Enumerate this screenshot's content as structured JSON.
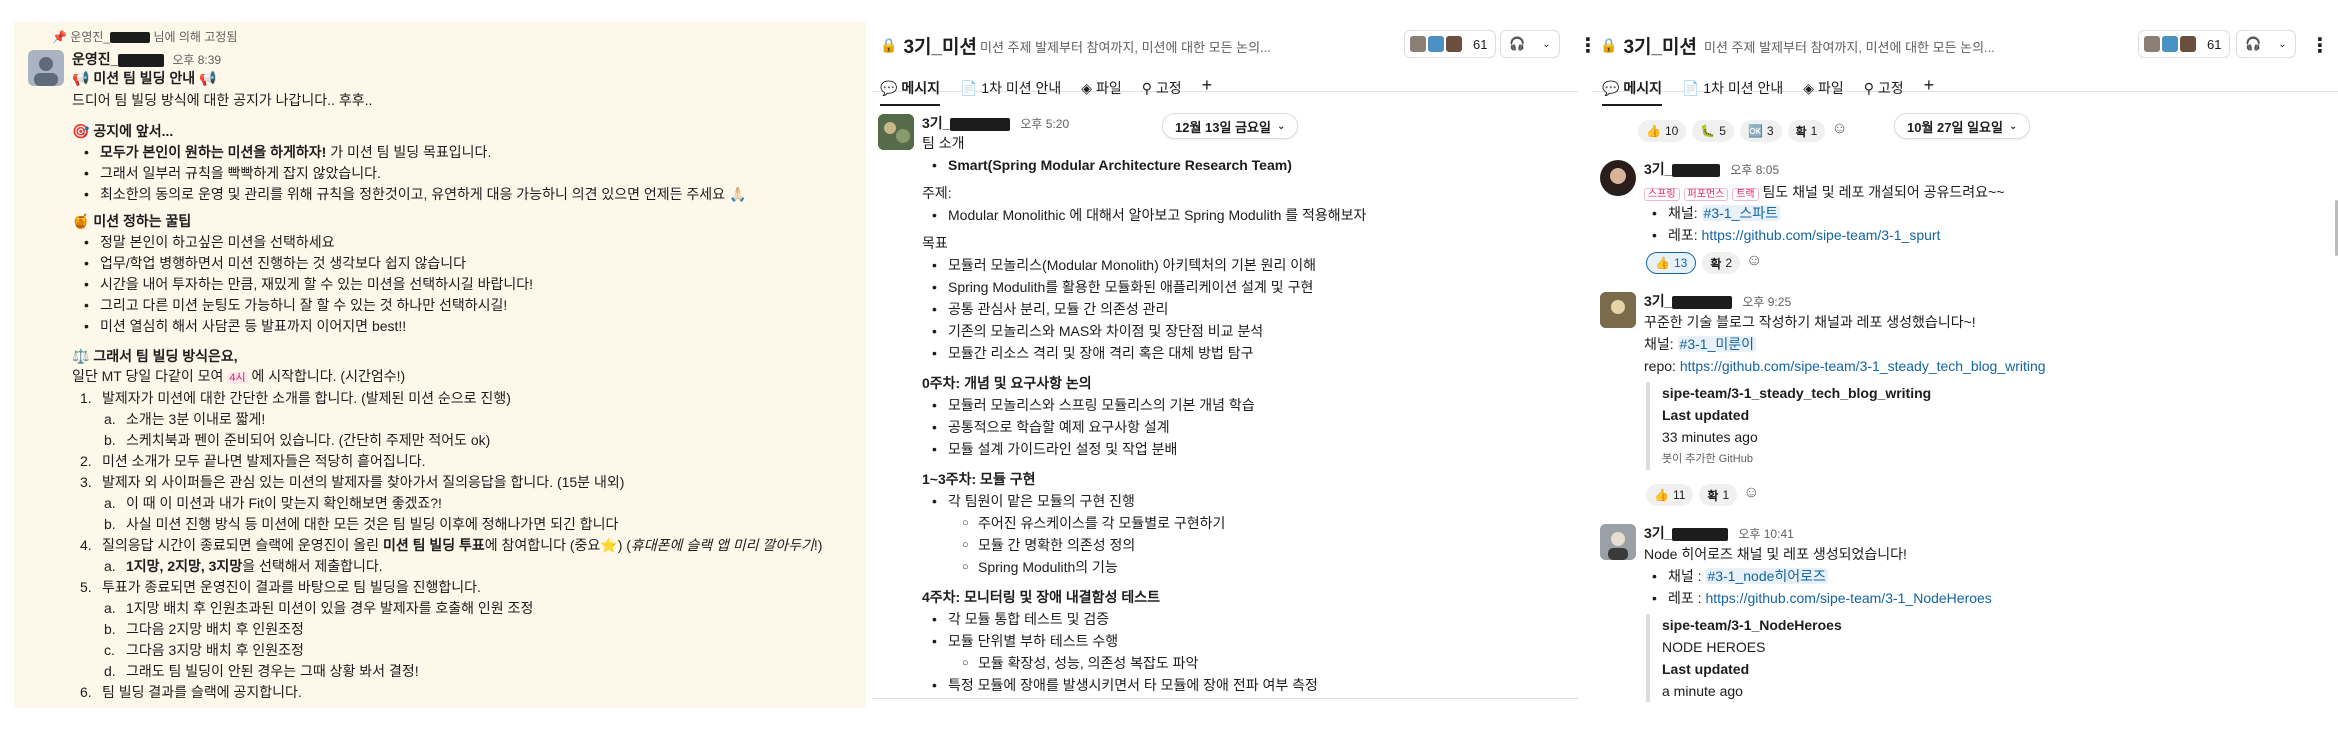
{
  "panel1": {
    "pinned_by": "운영진_",
    "pinned_suffix": "님에 의해 고정됨",
    "author": "운영진_",
    "time": "오후 8:39",
    "title": "📢 미션 팀 빌딩 안내 📢",
    "intro": "드디어 팀 빌딩 방식에 대한 공지가 나갑니다.. 후후..",
    "s1_title": "🎯 공지에 앞서...",
    "s1_items": [
      {
        "bold": "모두가 본인이 원하는 미션을 하게하자!",
        "rest": " 가 미션 팀 빌딩 목표입니다."
      },
      {
        "bold": "",
        "rest": "그래서 일부러 규칙을 빡빡하게 잡지 않았습니다."
      },
      {
        "bold": "",
        "rest": "최소한의 동의로 운영 및 관리를 위해 규칙을 정한것이고, 유연하게 대응 가능하니 의견 있으면 언제든 주세요 🙏🏻"
      }
    ],
    "s2_title": "🍯 미션 정하는 꿀팁",
    "s2_items": [
      "정말 본인이 하고싶은 미션을 선택하세요",
      "업무/학업 병행하면서 미션 진행하는 것 생각보다 쉽지 않습니다",
      "시간을 내어 투자하는 만큼, 재밌게 할 수 있는 미션을 선택하시길 바랍니다!",
      "그리고 다른 미션 눈팅도 가능하니 잘 할 수 있는 것 하나만 선택하시길!",
      "미션 열심히 해서 사담콘 등 발표까지 이어지면 best!!"
    ],
    "s3_title": "⚖️ 그래서 팀 빌딩 방식은요,",
    "s3_intro_a": "일단 MT 당일 다같이 모여 ",
    "s3_intro_time": "4시",
    "s3_intro_b": " 에 시작합니다. (시간엄수!)",
    "steps": [
      {
        "n": "1.",
        "text": "발제자가 미션에 대한 간단한 소개를 합니다. (발제된 미션 순으로 진행)"
      },
      {
        "n": "a.",
        "text": "소개는 3분 이내로 짧게!",
        "sub": true
      },
      {
        "n": "b.",
        "text": "스케치북과 펜이 준비되어 있습니다. (간단히 주제만 적어도 ok)",
        "sub": true
      },
      {
        "n": "2.",
        "text": "미션 소개가 모두 끝나면 발제자들은 적당히 흩어집니다."
      },
      {
        "n": "3.",
        "text": "발제자 외 사이퍼들은 관심 있는 미션의 발제자를 찾아가서 질의응답을 합니다. (15분 내외)"
      },
      {
        "n": "a.",
        "text": "이 때 이 미션과 내가 Fit이 맞는지 확인해보면 좋겠죠?!",
        "sub": true
      },
      {
        "n": "b.",
        "text": "사실 미션 진행 방식 등 미션에 대한 모든 것은 팀 빌딩 이후에 정해나가면 되긴 합니다",
        "sub": true
      },
      {
        "n": "4.",
        "text": "질의응답 시간이 종료되면 슬랙에 운영진이 올린 ",
        "bold": "미션 팀 빌딩 투표",
        "tail": "에 참여합니다 (중요⭐️) (",
        "italic": "휴대폰에 슬랙 앱 미리 깔아두기",
        "end": "!)"
      },
      {
        "n": "a.",
        "text": "",
        "bold": "1지망, 2지망, 3지망",
        "tail": "을 선택해서 제출합니다.",
        "sub": true
      },
      {
        "n": "5.",
        "text": "투표가 종료되면 운영진이 결과를 바탕으로 팀 빌딩을 진행합니다."
      },
      {
        "n": "a.",
        "text": "1지망 배치 후 인원초과된 미션이 있을 경우 발제자를 호출해 인원 조정",
        "sub": true
      },
      {
        "n": "b.",
        "text": "그다음 2지망 배치 후 인원조정",
        "sub": true
      },
      {
        "n": "c.",
        "text": "그다음 3지망 배치 후 인원조정",
        "sub": true
      },
      {
        "n": "d.",
        "text": "그래도 팀 빌딩이 안된 경우는 그때 상황 봐서 결정!",
        "sub": true
      },
      {
        "n": "6.",
        "text": "팀 빌딩 결과를 슬랙에 공지합니다."
      }
    ]
  },
  "panel2": {
    "channel": "3기_미션",
    "desc": "미션 주제 발제부터 참여까지, 미션에 대한 모든 논의...",
    "member_count": "61",
    "tabs": [
      "메시지",
      "1차 미션 안내",
      "파일",
      "고정",
      "+"
    ],
    "date": "12월 13일 금요일",
    "author": "3기_",
    "time": "오후 5:20",
    "lines": [
      {
        "t": "팀 소개",
        "k": "p"
      },
      {
        "t": "Smart(Spring Modular Architecture Research Team)",
        "k": "bul",
        "b": true,
        "pre": "Smart("
      },
      {
        "t": "주제:",
        "k": "p"
      },
      {
        "t": "Modular Monolithic 에 대해서 알아보고 Spring Modulith 를 적용해보자",
        "k": "bul"
      },
      {
        "t": "목표",
        "k": "p"
      },
      {
        "t": "모듈러 모놀리스(Modular Monolith) 아키텍처의 기본 원리 이해",
        "k": "bul"
      },
      {
        "t": "Spring Modulith를 활용한 모듈화된 애플리케이션 설계 및 구현",
        "k": "bul"
      },
      {
        "t": "공통 관심사 분리, 모듈 간 의존성 관리",
        "k": "bul"
      },
      {
        "t": "기존의 모놀리스와 MAS와 차이점 및 장단점 비교 분석",
        "k": "bul"
      },
      {
        "t": "모듈간 리소스 격리 및 장애 격리 혹은 대체 방법 탐구",
        "k": "bul"
      },
      {
        "t": "0주차: 개념 및 요구사항 논의",
        "k": "h"
      },
      {
        "t": "모듈러 모놀리스와 스프링 모듈리스의 기본 개념 학습",
        "k": "bul"
      },
      {
        "t": "공통적으로 학습할 예제 요구사항 설계",
        "k": "bul"
      },
      {
        "t": "모듈 설계 가이드라인 설정 및 작업 분배",
        "k": "bul"
      },
      {
        "t": "1~3주차: 모듈 구현",
        "k": "h"
      },
      {
        "t": "각 팀원이 맡은 모듈의 구현 진행",
        "k": "bul"
      },
      {
        "t": "주어진 유스케이스를 각 모듈별로 구현하기",
        "k": "circ"
      },
      {
        "t": "모듈 간 명확한 의존성 정의",
        "k": "circ"
      },
      {
        "t": "Spring Modulith의 기능",
        "k": "circ"
      },
      {
        "t": "4주차: 모니터링 및 장애 내결함성 테스트",
        "k": "h"
      },
      {
        "t": "각 모듈 통합 테스트 및 검증",
        "k": "bul"
      },
      {
        "t": "모듈 단위별 부하 테스트 수행",
        "k": "bul"
      },
      {
        "t": "모듈 확장성, 성능, 의존성 복잡도 파악",
        "k": "circ"
      },
      {
        "t": "특정 모듈에 장애를 발생시키면서 타 모듈에 장애 전파 여부 측정",
        "k": "bul"
      }
    ]
  },
  "panel3": {
    "channel": "3기_미션",
    "desc": "미션 주제 발제부터 참여까지, 미션에 대한 모든 논의...",
    "member_count": "61",
    "tabs": [
      "메시지",
      "1차 미션 안내",
      "파일",
      "고정",
      "+"
    ],
    "date": "10월 27일 일요일",
    "top_reacts": [
      {
        "e": "👍",
        "c": "10"
      },
      {
        "e": "🐛",
        "c": "5"
      },
      {
        "e": "🆗",
        "c": "3"
      },
      {
        "e": "확",
        "c": "1"
      }
    ],
    "m1": {
      "author": "3기_",
      "time": "오후 8:05",
      "tag1": "스프링",
      "tag2": "퍼포먼스",
      "tag3": "트랙",
      "text": " 팀도 채널 및 레포 개설되어 공유드려요~~",
      "chan_label": "채널: ",
      "chan": "#3-1_스파트",
      "repo_label": "레포: ",
      "repo": "https://github.com/sipe-team/3-1_spurt",
      "reacts": [
        {
          "e": "👍",
          "c": "13"
        },
        {
          "e": "확",
          "c": "2"
        }
      ]
    },
    "m2": {
      "author": "3기_",
      "time": "오후 9:25",
      "text": "꾸준한 기술 블로그 작성하기 채널과 레포 생성했습니다~!",
      "chan_label": "채널: ",
      "chan": "#3-1_미룬이",
      "repo_label": "repo: ",
      "repo": "https://github.com/sipe-team/3-1_steady_tech_blog_writing",
      "unfurl_title": "sipe-team/3-1_steady_tech_blog_writing",
      "unfurl_label": "Last updated",
      "unfurl_value": "33 minutes ago",
      "unfurl_src": "봇이 추가한 GitHub",
      "reacts": [
        {
          "e": "👍",
          "c": "11"
        },
        {
          "e": "확",
          "c": "1"
        }
      ]
    },
    "m3": {
      "author": "3기_",
      "time": "오후 10:41",
      "text": "Node 히어로즈 채널 및 레포 생성되었습니다!",
      "chan_label": "채널 : ",
      "chan": "#3-1_node히어로즈",
      "repo_label": "레포 : ",
      "repo": "https://github.com/sipe-team/3-1_NodeHeroes",
      "unfurl_title": "sipe-team/3-1_NodeHeroes",
      "unfurl_desc": "NODE HEROES",
      "unfurl_label": "Last updated",
      "unfurl_value": "a minute ago"
    }
  }
}
